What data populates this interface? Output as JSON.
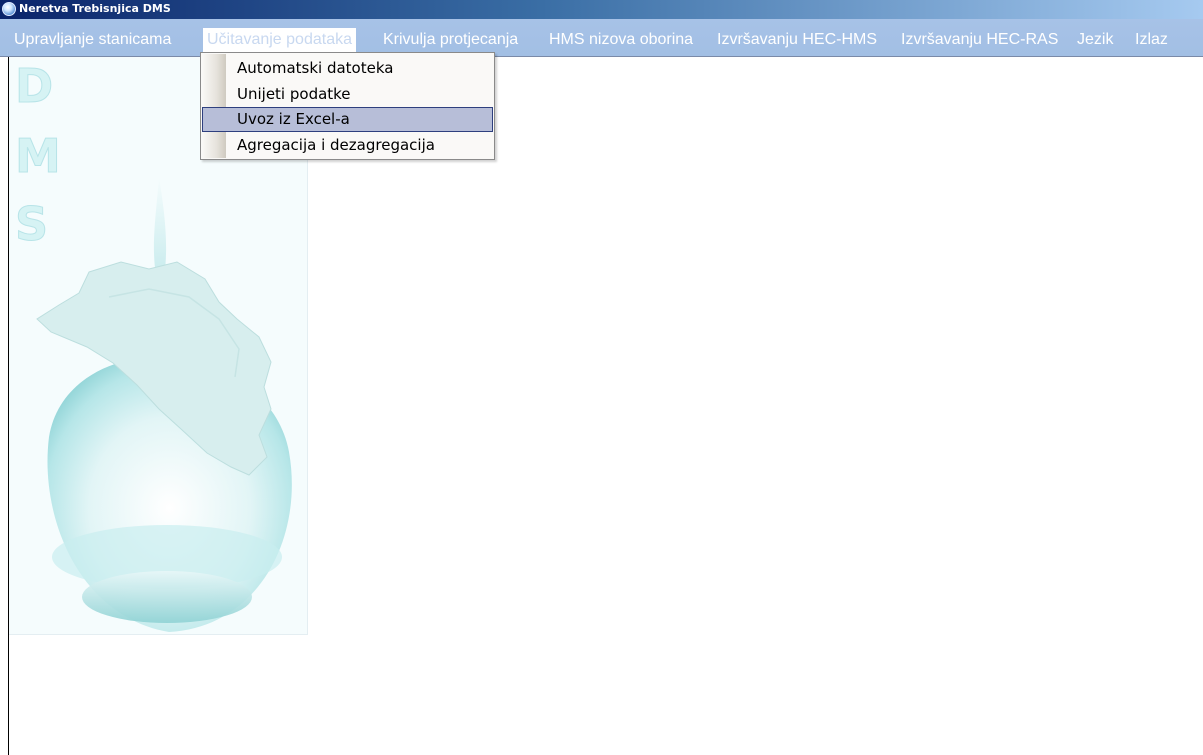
{
  "window": {
    "title": "Neretva Trebisnjica DMS",
    "icon": "water-drop-icon"
  },
  "menubar": {
    "items": [
      {
        "label": "Upravljanje stanicama"
      },
      {
        "label": "Učitavanje podataka",
        "active": true
      },
      {
        "label": "Krivulja protjecanja"
      },
      {
        "label": "HMS nizova oborina"
      },
      {
        "label": "Izvršavanju HEC-HMS"
      },
      {
        "label": "Izvršavanju HEC-RAS"
      },
      {
        "label": "Jezik"
      },
      {
        "label": "Izlaz"
      }
    ]
  },
  "dropdown": {
    "items": [
      {
        "label": "Automatski datoteka"
      },
      {
        "label": "Unijeti podatke"
      },
      {
        "label": "Uvoz iz Excel-a",
        "highlighted": true
      },
      {
        "label": "Agregacija i dezagregacija"
      }
    ]
  },
  "logo": {
    "letters": [
      "D",
      "M",
      "S"
    ]
  },
  "colors": {
    "title_bar_start": "#0a246a",
    "menubar_bg": "#a7c2e7",
    "highlight_bg": "#b7bed8",
    "highlight_border": "#2e3f7e",
    "logo_tint": "#d6f3f4"
  }
}
